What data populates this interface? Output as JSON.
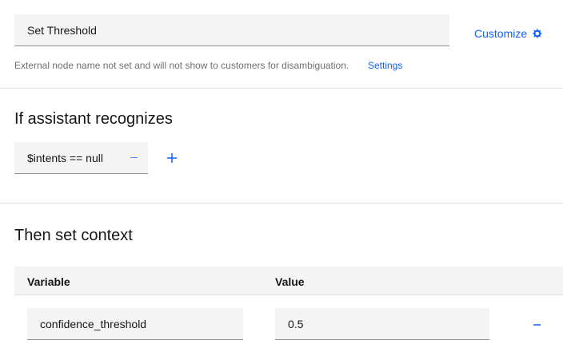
{
  "node": {
    "name_value": "Set Threshold",
    "customize_label": "Customize",
    "helper_text": "External node name not set and will not show to customers for disambiguation.",
    "settings_label": "Settings"
  },
  "conditions": {
    "title": "If assistant recognizes",
    "items": [
      {
        "text": "$intents == null"
      }
    ]
  },
  "context": {
    "title": "Then set context",
    "columns": {
      "variable": "Variable",
      "value": "Value"
    },
    "rows": [
      {
        "variable": "confidence_threshold",
        "value": "0.5"
      }
    ]
  },
  "colors": {
    "accent": "#0f62fe",
    "accent_light": "#4589ff",
    "field_bg": "#f4f4f4",
    "divider": "#e0e0e0",
    "helper_text": "#6f6f6f"
  },
  "icons": {
    "customize": "gear-icon",
    "remove": "minus-icon",
    "add": "plus-icon"
  }
}
